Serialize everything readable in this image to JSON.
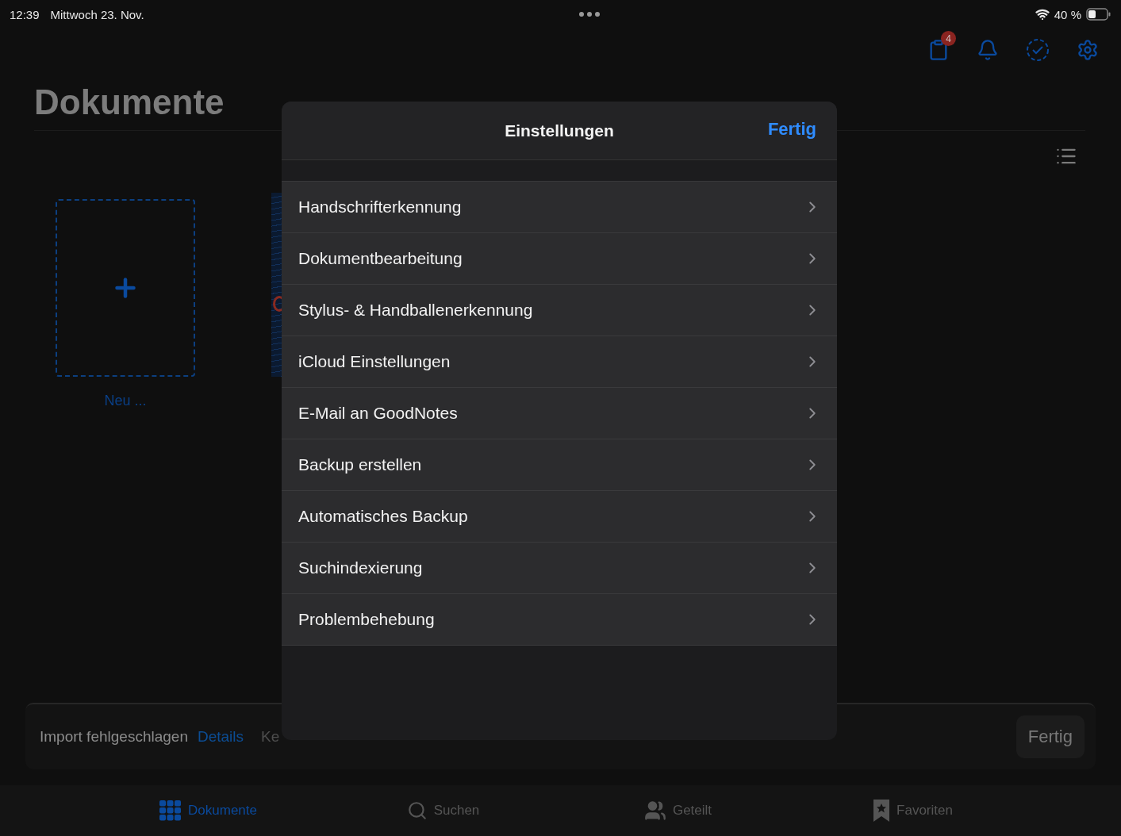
{
  "status_bar": {
    "time": "12:39",
    "date": "Mittwoch 23. Nov.",
    "battery": "40 %"
  },
  "toolbar": {
    "badge": "4"
  },
  "title": "Dokumente",
  "new_card": {
    "label": "Neu ..."
  },
  "import_bar": {
    "message": "Import fehlgeschlagen",
    "link": "Details",
    "status": "Ke",
    "button": "Fertig"
  },
  "tab_bar": [
    {
      "label": "Dokumente",
      "kind": "grid",
      "selected": true
    },
    {
      "label": "Suchen",
      "kind": "search",
      "selected": false
    },
    {
      "label": "Geteilt",
      "kind": "people",
      "selected": false
    },
    {
      "label": "Favoriten",
      "kind": "bookmark",
      "selected": false
    }
  ],
  "modal": {
    "title": "Einstellungen",
    "done": "Fertig",
    "items": [
      {
        "label": "Handschrifterkennung"
      },
      {
        "label": "Dokumentbearbeitung"
      },
      {
        "label": "Stylus- & Handballenerkennung"
      },
      {
        "label": "iCloud Einstellungen"
      },
      {
        "label": "E-Mail an GoodNotes"
      },
      {
        "label": "Backup erstellen"
      },
      {
        "label": "Automatisches Backup"
      },
      {
        "label": "Suchindexierung"
      },
      {
        "label": "Problembehebung"
      }
    ]
  }
}
